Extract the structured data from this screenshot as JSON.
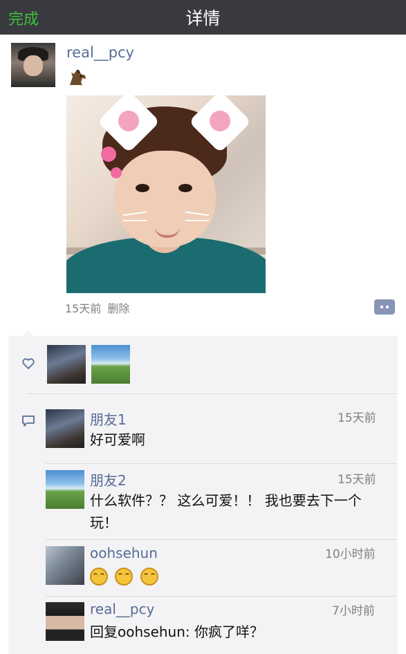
{
  "topbar": {
    "done_label": "完成",
    "title": "详情"
  },
  "post": {
    "username": "real__pcy",
    "timestamp": "15天前",
    "delete_label": "删除",
    "emoji": "horse-emoji"
  },
  "likes": {
    "icon": "heart-outline-icon",
    "count_shown": 2
  },
  "comments": [
    {
      "name": "朋友1",
      "time": "15天前",
      "text": "好可爱啊"
    },
    {
      "name": "朋友2",
      "time": "15天前",
      "text": "什么软件？？ 这么可爱！！ 我也要去下一个玩！"
    },
    {
      "name": "oohsehun",
      "time": "10小时前",
      "text": "",
      "emojis": 3
    },
    {
      "name": "real__pcy",
      "time": "7小时前",
      "text": "回复oohsehun: 你疯了咩？"
    }
  ],
  "colors": {
    "topbar_bg": "#393a3f",
    "done_green": "#3fc13a",
    "name_blue": "#576b95",
    "panel_bg": "#f3f3f5"
  }
}
